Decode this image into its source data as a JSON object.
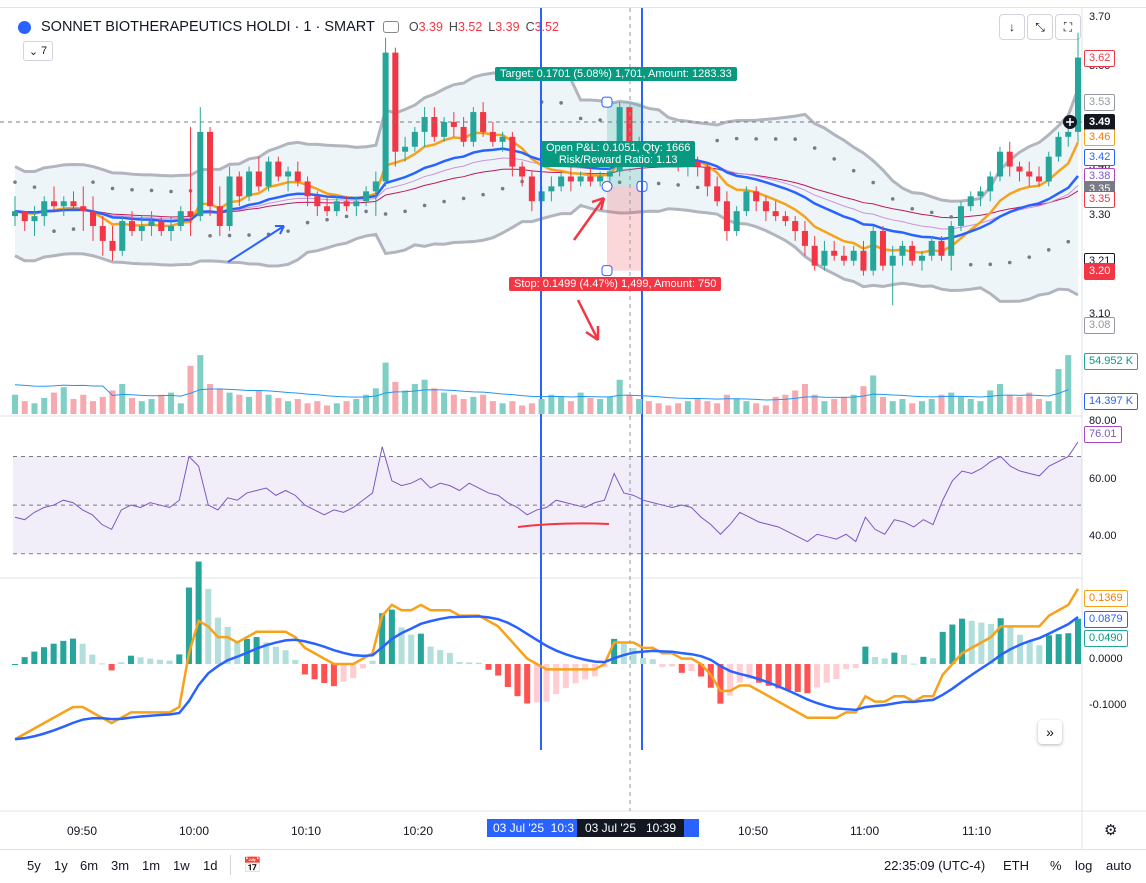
{
  "symbol": {
    "title": "SONNET BIOTHERAPEUTICS HOLDI · 1 · SMART",
    "ohlc": [
      {
        "label": "O",
        "value": "3.39"
      },
      {
        "label": "H",
        "value": "3.52"
      },
      {
        "label": "L",
        "value": "3.39"
      },
      {
        "label": "C",
        "value": "3.52"
      }
    ],
    "indicator_count": "7"
  },
  "toolbar": {
    "down_arrow": "↓",
    "collapse": "⤡",
    "fullscreen": "⛶"
  },
  "price_axis": {
    "plain_ticks": [
      {
        "text": "3.70",
        "price": 3.7
      },
      {
        "text": "3.60",
        "price": 3.6
      },
      {
        "text": "3.40",
        "price": 3.4
      },
      {
        "text": "3.30",
        "price": 3.3
      },
      {
        "text": "3.10",
        "price": 3.1
      }
    ],
    "labels": [
      {
        "text": "3.62",
        "price": 3.62,
        "style": "red"
      },
      {
        "text": "3.53",
        "price": 3.53,
        "style": "grey"
      },
      {
        "text": "3.49",
        "price": 3.49,
        "style": "dark"
      },
      {
        "text": "3.46",
        "price": 3.46,
        "style": "orange"
      },
      {
        "text": "3.42",
        "price": 3.42,
        "style": "blue"
      },
      {
        "text": "3.38",
        "price": 3.38,
        "style": "purple"
      },
      {
        "text": "3.35",
        "price": 3.355,
        "style": "grey-fill"
      },
      {
        "text": "3.35",
        "price": 3.335,
        "style": "red"
      },
      {
        "text": "3.21",
        "price": 3.21,
        "style": "plain-box"
      },
      {
        "text": "3.20",
        "price": 3.19,
        "style": "red-fill"
      },
      {
        "text": "3.08",
        "price": 3.08,
        "style": "grey"
      }
    ],
    "volume_labels": [
      {
        "text": "54.952 K",
        "style": "teal"
      },
      {
        "text": "14.397 K",
        "style": "blue"
      }
    ],
    "rsi_labels": [
      {
        "text": "80.00"
      },
      {
        "text": "76.01",
        "style": "purple"
      },
      {
        "text": "60.00"
      },
      {
        "text": "40.00"
      }
    ],
    "macd_labels": [
      {
        "text": "0.1369",
        "style": "orange"
      },
      {
        "text": "0.0879",
        "style": "blue"
      },
      {
        "text": "0.0490",
        "style": "teal"
      },
      {
        "text": "0.0000"
      },
      {
        "text": "-0.1000"
      }
    ]
  },
  "time_axis": {
    "ticks": [
      "09:50",
      "10:00",
      "10:10",
      "10:20",
      "10:50",
      "11:00",
      "11:10"
    ],
    "crosshair_labels": [
      {
        "text": "03 Jul '25  10:3",
        "style": "blue"
      },
      {
        "text": "03 Jul '25   10:39",
        "style": "dark"
      }
    ]
  },
  "position_tool": {
    "target_label": "Target: 0.1701 (5.08%) 1,701, Amount: 1283.33",
    "pnl_label_line1": "Open P&L: 0.1051, Qty: 1666",
    "pnl_label_line2": "Risk/Reward Ratio: 1.13",
    "stop_label": "Stop: 0.1499 (4.47%) 1,499, Amount: 750"
  },
  "bottom_bar": {
    "ranges": [
      "5y",
      "1y",
      "6m",
      "3m",
      "1m",
      "1w",
      "1d"
    ],
    "time": "22:35:09 (UTC-4)",
    "session": "ETH",
    "percent": "%",
    "log": "log",
    "auto": "auto"
  },
  "icons": [
    "tv-logo-icon",
    "eye-icon",
    "chevron-down-icon",
    "arrow-down-icon",
    "collapse-icon",
    "fullscreen-icon",
    "crosshair-plus-icon",
    "calendar-goto-icon",
    "settings-gear-icon",
    "expand-chevrons-icon"
  ],
  "colors": {
    "up": "#26a69a",
    "down": "#f23645",
    "ema_fast": "#f7a21b",
    "ema_slow": "#2962ff",
    "band": "#b2b5be",
    "rsi": "#7e57c2",
    "volume_ma": "#2196f3"
  },
  "chart_data": {
    "type": "candlestick",
    "price_range": [
      3.05,
      3.72
    ],
    "candles": [
      [
        3.3,
        3.34,
        3.28,
        3.31
      ],
      [
        3.31,
        3.31,
        3.27,
        3.29
      ],
      [
        3.29,
        3.32,
        3.26,
        3.3
      ],
      [
        3.3,
        3.34,
        3.28,
        3.33
      ],
      [
        3.33,
        3.36,
        3.31,
        3.32
      ],
      [
        3.32,
        3.34,
        3.3,
        3.33
      ],
      [
        3.33,
        3.35,
        3.31,
        3.32
      ],
      [
        3.32,
        3.36,
        3.27,
        3.31
      ],
      [
        3.31,
        3.34,
        3.25,
        3.28
      ],
      [
        3.28,
        3.3,
        3.22,
        3.25
      ],
      [
        3.25,
        3.28,
        3.21,
        3.23
      ],
      [
        3.23,
        3.3,
        3.22,
        3.29
      ],
      [
        3.29,
        3.31,
        3.26,
        3.27
      ],
      [
        3.27,
        3.3,
        3.25,
        3.28
      ],
      [
        3.28,
        3.31,
        3.26,
        3.29
      ],
      [
        3.29,
        3.3,
        3.26,
        3.27
      ],
      [
        3.27,
        3.3,
        3.25,
        3.28
      ],
      [
        3.28,
        3.32,
        3.27,
        3.31
      ],
      [
        3.31,
        3.48,
        3.26,
        3.3
      ],
      [
        3.3,
        3.52,
        3.29,
        3.47
      ],
      [
        3.47,
        3.48,
        3.3,
        3.32
      ],
      [
        3.32,
        3.36,
        3.26,
        3.28
      ],
      [
        3.28,
        3.4,
        3.27,
        3.38
      ],
      [
        3.38,
        3.39,
        3.32,
        3.34
      ],
      [
        3.34,
        3.4,
        3.33,
        3.39
      ],
      [
        3.39,
        3.42,
        3.35,
        3.36
      ],
      [
        3.36,
        3.42,
        3.35,
        3.41
      ],
      [
        3.41,
        3.42,
        3.37,
        3.38
      ],
      [
        3.38,
        3.4,
        3.35,
        3.39
      ],
      [
        3.39,
        3.41,
        3.36,
        3.37
      ],
      [
        3.37,
        3.38,
        3.32,
        3.34
      ],
      [
        3.34,
        3.35,
        3.3,
        3.32
      ],
      [
        3.32,
        3.34,
        3.3,
        3.31
      ],
      [
        3.31,
        3.34,
        3.3,
        3.33
      ],
      [
        3.33,
        3.34,
        3.31,
        3.32
      ],
      [
        3.32,
        3.34,
        3.3,
        3.33
      ],
      [
        3.33,
        3.36,
        3.32,
        3.35
      ],
      [
        3.35,
        3.39,
        3.3,
        3.37
      ],
      [
        3.37,
        3.66,
        3.36,
        3.63
      ],
      [
        3.63,
        3.64,
        3.4,
        3.43
      ],
      [
        3.43,
        3.46,
        3.41,
        3.44
      ],
      [
        3.44,
        3.48,
        3.43,
        3.47
      ],
      [
        3.47,
        3.52,
        3.44,
        3.5
      ],
      [
        3.5,
        3.52,
        3.45,
        3.46
      ],
      [
        3.46,
        3.5,
        3.45,
        3.49
      ],
      [
        3.49,
        3.51,
        3.46,
        3.48
      ],
      [
        3.48,
        3.5,
        3.44,
        3.45
      ],
      [
        3.45,
        3.52,
        3.44,
        3.51
      ],
      [
        3.51,
        3.53,
        3.46,
        3.47
      ],
      [
        3.47,
        3.49,
        3.44,
        3.45
      ],
      [
        3.45,
        3.47,
        3.43,
        3.46
      ],
      [
        3.46,
        3.47,
        3.38,
        3.4
      ],
      [
        3.4,
        3.41,
        3.36,
        3.38
      ],
      [
        3.38,
        3.39,
        3.31,
        3.33
      ],
      [
        3.33,
        3.36,
        3.32,
        3.35
      ],
      [
        3.35,
        3.38,
        3.33,
        3.36
      ],
      [
        3.36,
        3.39,
        3.35,
        3.38
      ],
      [
        3.38,
        3.4,
        3.35,
        3.37
      ],
      [
        3.37,
        3.39,
        3.36,
        3.38
      ],
      [
        3.38,
        3.4,
        3.36,
        3.37
      ],
      [
        3.37,
        3.39,
        3.36,
        3.38
      ],
      [
        3.38,
        3.4,
        3.37,
        3.39
      ],
      [
        3.39,
        3.53,
        3.38,
        3.52
      ],
      [
        3.52,
        3.52,
        3.42,
        3.44
      ],
      [
        3.44,
        3.46,
        3.43,
        3.45
      ],
      [
        3.45,
        3.45,
        3.42,
        3.43
      ],
      [
        3.43,
        3.44,
        3.41,
        3.42
      ],
      [
        3.42,
        3.43,
        3.4,
        3.41
      ],
      [
        3.41,
        3.42,
        3.39,
        3.4
      ],
      [
        3.4,
        3.42,
        3.38,
        3.41
      ],
      [
        3.41,
        3.42,
        3.38,
        3.4
      ],
      [
        3.4,
        3.41,
        3.34,
        3.36
      ],
      [
        3.36,
        3.38,
        3.32,
        3.33
      ],
      [
        3.33,
        3.35,
        3.25,
        3.27
      ],
      [
        3.27,
        3.32,
        3.26,
        3.31
      ],
      [
        3.31,
        3.36,
        3.3,
        3.35
      ],
      [
        3.35,
        3.36,
        3.31,
        3.33
      ],
      [
        3.33,
        3.34,
        3.29,
        3.31
      ],
      [
        3.31,
        3.33,
        3.29,
        3.3
      ],
      [
        3.3,
        3.31,
        3.28,
        3.29
      ],
      [
        3.29,
        3.3,
        3.25,
        3.27
      ],
      [
        3.27,
        3.29,
        3.22,
        3.24
      ],
      [
        3.24,
        3.26,
        3.19,
        3.2
      ],
      [
        3.2,
        3.25,
        3.19,
        3.23
      ],
      [
        3.23,
        3.25,
        3.21,
        3.22
      ],
      [
        3.22,
        3.24,
        3.2,
        3.21
      ],
      [
        3.21,
        3.24,
        3.2,
        3.23
      ],
      [
        3.23,
        3.25,
        3.18,
        3.19
      ],
      [
        3.19,
        3.28,
        3.18,
        3.27
      ],
      [
        3.27,
        3.28,
        3.19,
        3.2
      ],
      [
        3.2,
        3.24,
        3.12,
        3.22
      ],
      [
        3.22,
        3.25,
        3.2,
        3.24
      ],
      [
        3.24,
        3.25,
        3.2,
        3.21
      ],
      [
        3.21,
        3.23,
        3.19,
        3.22
      ],
      [
        3.22,
        3.26,
        3.21,
        3.25
      ],
      [
        3.25,
        3.26,
        3.21,
        3.22
      ],
      [
        3.22,
        3.29,
        3.19,
        3.28
      ],
      [
        3.28,
        3.33,
        3.27,
        3.32
      ],
      [
        3.32,
        3.35,
        3.31,
        3.34
      ],
      [
        3.34,
        3.36,
        3.32,
        3.35
      ],
      [
        3.35,
        3.39,
        3.33,
        3.38
      ],
      [
        3.38,
        3.44,
        3.37,
        3.43
      ],
      [
        3.43,
        3.45,
        3.38,
        3.4
      ],
      [
        3.4,
        3.41,
        3.37,
        3.39
      ],
      [
        3.39,
        3.41,
        3.36,
        3.38
      ],
      [
        3.38,
        3.4,
        3.36,
        3.37
      ],
      [
        3.37,
        3.43,
        3.36,
        3.42
      ],
      [
        3.42,
        3.47,
        3.41,
        3.46
      ],
      [
        3.46,
        3.49,
        3.44,
        3.47
      ],
      [
        3.47,
        3.67,
        3.45,
        3.62
      ]
    ],
    "volume": [
      18,
      12,
      10,
      15,
      20,
      25,
      14,
      18,
      12,
      16,
      22,
      28,
      15,
      12,
      14,
      18,
      20,
      10,
      45,
      55,
      28,
      24,
      20,
      18,
      16,
      22,
      18,
      15,
      12,
      14,
      10,
      12,
      8,
      10,
      12,
      14,
      18,
      24,
      48,
      30,
      22,
      28,
      32,
      24,
      20,
      18,
      14,
      16,
      18,
      12,
      10,
      12,
      8,
      10,
      14,
      18,
      16,
      12,
      20,
      15,
      14,
      16,
      32,
      18,
      14,
      12,
      10,
      8,
      10,
      12,
      14,
      12,
      10,
      18,
      14,
      12,
      10,
      8,
      16,
      18,
      22,
      28,
      18,
      12,
      14,
      16,
      18,
      26,
      36,
      16,
      12,
      14,
      10,
      12,
      14,
      18,
      20,
      16,
      14,
      12,
      22,
      28,
      18,
      16,
      20,
      14,
      12,
      42,
      55
    ],
    "rsi": [
      45,
      44,
      47,
      49,
      50,
      52,
      51,
      48,
      46,
      42,
      40,
      48,
      50,
      49,
      51,
      50,
      49,
      52,
      70,
      66,
      50,
      48,
      53,
      52,
      55,
      56,
      57,
      54,
      56,
      54,
      50,
      48,
      46,
      48,
      47,
      49,
      52,
      55,
      74,
      60,
      58,
      59,
      61,
      57,
      59,
      58,
      56,
      59,
      57,
      55,
      54,
      51,
      49,
      46,
      48,
      49,
      52,
      51,
      50,
      49,
      51,
      52,
      63,
      55,
      54,
      52,
      51,
      50,
      49,
      50,
      49,
      45,
      42,
      38,
      42,
      47,
      45,
      43,
      42,
      41,
      39,
      37,
      35,
      38,
      37,
      36,
      38,
      35,
      45,
      40,
      38,
      44,
      43,
      41,
      44,
      42,
      52,
      60,
      64,
      63,
      65,
      68,
      70,
      66,
      64,
      63,
      62,
      66,
      68,
      70,
      76
    ],
    "macd": [
      -0.14,
      -0.13,
      -0.12,
      -0.11,
      -0.1,
      -0.09,
      -0.08,
      -0.08,
      -0.09,
      -0.1,
      -0.11,
      -0.1,
      -0.09,
      -0.09,
      -0.09,
      -0.09,
      -0.09,
      -0.08,
      0.02,
      0.08,
      0.07,
      0.05,
      0.05,
      0.04,
      0.05,
      0.06,
      0.06,
      0.06,
      0.06,
      0.05,
      0.03,
      0.02,
      0.01,
      0.0,
      0.0,
      0.0,
      0.01,
      0.02,
      0.09,
      0.11,
      0.1,
      0.1,
      0.11,
      0.1,
      0.1,
      0.1,
      0.09,
      0.09,
      0.09,
      0.08,
      0.07,
      0.05,
      0.03,
      0.01,
      0.0,
      -0.01,
      -0.01,
      -0.01,
      -0.01,
      -0.01,
      -0.01,
      0.0,
      0.04,
      0.04,
      0.04,
      0.03,
      0.03,
      0.02,
      0.02,
      0.01,
      0.01,
      0.0,
      -0.02,
      -0.05,
      -0.05,
      -0.04,
      -0.04,
      -0.05,
      -0.06,
      -0.07,
      -0.08,
      -0.09,
      -0.1,
      -0.1,
      -0.1,
      -0.1,
      -0.09,
      -0.09,
      -0.06,
      -0.07,
      -0.07,
      -0.06,
      -0.06,
      -0.07,
      -0.06,
      -0.06,
      -0.02,
      0.0,
      0.02,
      0.03,
      0.04,
      0.05,
      0.07,
      0.07,
      0.07,
      0.07,
      0.07,
      0.09,
      0.1,
      0.11,
      0.14
    ],
    "ema_periods": [
      9,
      21
    ],
    "bands": {
      "period": 20,
      "stddev": 2
    },
    "time_ticks": [
      "09:50",
      "10:00",
      "10:10",
      "10:20",
      "10:50",
      "11:00",
      "11:10"
    ],
    "rsi_range": [
      20,
      85
    ],
    "macd_range": [
      -0.16,
      0.16
    ]
  }
}
